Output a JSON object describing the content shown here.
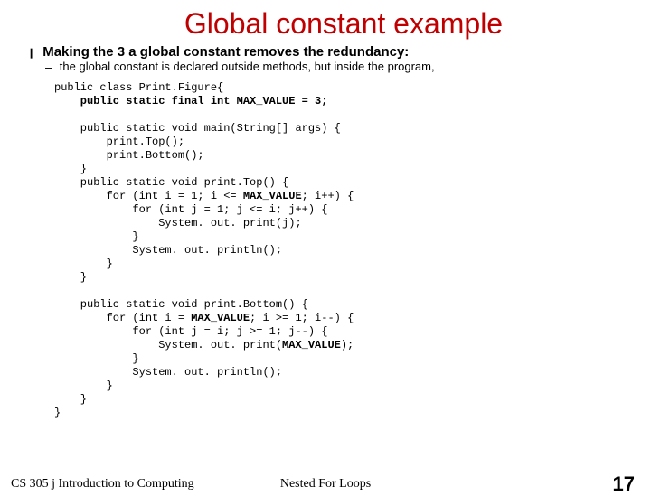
{
  "title": "Global constant example",
  "bullet": "Making the 3 a global constant removes the redundancy:",
  "sub_bullet": "the global constant is declared outside methods, but inside the program,",
  "code": {
    "l1": "public class Print.Figure{",
    "l2": "    public static final int MAX_VALUE = 3;",
    "l3": "    public static void main(String[] args) {",
    "l4": "        print.Top();",
    "l5": "        print.Bottom();",
    "l6": "    }",
    "l7": "    public static void print.Top() {",
    "l8a": "        for (int i = 1; i <= ",
    "l8b": "MAX_VALUE",
    "l8c": "; i++) {",
    "l9": "            for (int j = 1; j <= i; j++) {",
    "l10": "                System. out. print(j);",
    "l11": "            }",
    "l12": "            System. out. println();",
    "l13": "        }",
    "l14": "    }",
    "l15": "    public static void print.Bottom() {",
    "l16a": "        for (int i = ",
    "l16b": "MAX_VALUE",
    "l16c": "; i >= 1; i--) {",
    "l17": "            for (int j = i; j >= 1; j--) {",
    "l18a": "                System. out. print(",
    "l18b": "MAX_VALUE",
    "l18c": ");",
    "l19": "            }",
    "l20": "            System. out. println();",
    "l21": "        }",
    "l22": "    }",
    "l23": "}"
  },
  "footer": {
    "left": "CS 305 j Introduction to Computing",
    "center": "Nested For Loops",
    "right": "17"
  }
}
